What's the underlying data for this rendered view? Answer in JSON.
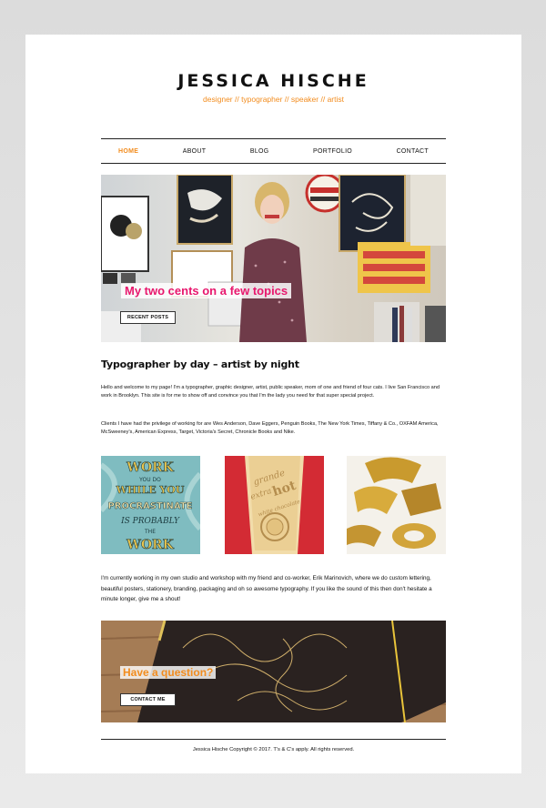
{
  "site": {
    "title": "JESSICA HISCHE",
    "tagline": "designer // typographer // speaker // artist"
  },
  "nav": {
    "items": [
      "HOME",
      "ABOUT",
      "BLOG",
      "PORTFOLIO",
      "CONTACT"
    ],
    "active": "HOME"
  },
  "hero": {
    "headline": "My two cents on a few topics",
    "button": "RECENT POSTS"
  },
  "intro": {
    "heading": "Typographer by day – artist by night",
    "p1": "Hello and welcome to my page! I'm a typographer, graphic designer, artist, public speaker, mom of one and friend of four cats. I live San Francisco and work in Brooklyn. This site is for me to show off and convince you that I'm the lady you need for that super special project.",
    "p2": "Clients I have had the privilege of working for are Wes Anderson, Dave Eggers, Penguin Books, The New York Times, Tiffany & Co., OXFAM America, McSweeney's, American Express, Target, Victoria's Secret, Chronicle Books and Nike.",
    "p3": "I'm currently working in my own studio and workshop with my friend and co-worker, Erik Marinovich, where we do custom lettering, beautiful posters, stationery, branding, packaging and oh so awesome typography. If you like the sound of this then don't hesitate a minute longer, give me a shout!"
  },
  "thumbs": {
    "t1": {
      "lines": [
        "WORK",
        "YOU DO",
        "WHILE YOU",
        "PROCRASTINATE",
        "IS PROBABLY",
        "THE",
        "WORK"
      ]
    },
    "t2": {
      "lines": [
        "grande",
        "extra",
        "hot",
        "white chocolate"
      ]
    }
  },
  "cta": {
    "headline": "Have a question?",
    "button": "CONTACT ME"
  },
  "footer": {
    "text": "Jessica Hische Copyright © 2017. T's & C's apply. All rights reserved."
  },
  "colors": {
    "accent": "#f28c1e",
    "hero_headline": "#e8176d"
  }
}
